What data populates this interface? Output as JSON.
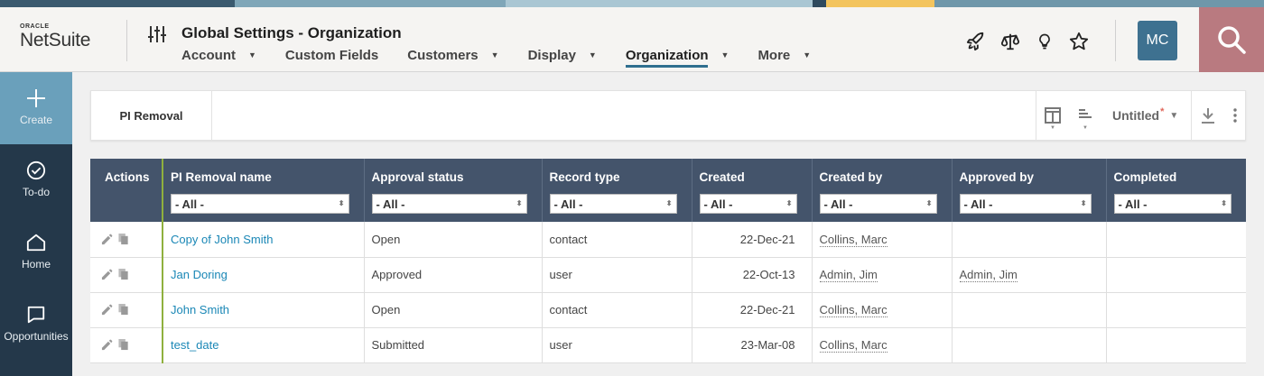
{
  "brand": {
    "oracle": "ORACLE",
    "product": "NetSuite"
  },
  "header": {
    "title": "Global Settings - Organization",
    "nav": [
      {
        "label": "Account",
        "has_menu": true
      },
      {
        "label": "Custom Fields",
        "has_menu": false
      },
      {
        "label": "Customers",
        "has_menu": true
      },
      {
        "label": "Display",
        "has_menu": true
      },
      {
        "label": "Organization",
        "has_menu": true,
        "active": true
      },
      {
        "label": "More",
        "has_menu": true
      }
    ],
    "icons": [
      "rocket-icon",
      "scale-icon",
      "lightbulb-icon",
      "star-icon"
    ],
    "avatar": "MC",
    "accent_color": "#2f6f8f"
  },
  "sidebar": {
    "items": [
      {
        "label": "Create",
        "icon": "plus-icon"
      },
      {
        "label": "To-do",
        "icon": "check-circle-icon"
      },
      {
        "label": "Home",
        "icon": "home-icon"
      },
      {
        "label": "Opportunities",
        "icon": "chat-bubble-icon"
      }
    ]
  },
  "saved_search": {
    "tab_label": "PI Removal",
    "view_name": "Untitled",
    "modified_marker": "*"
  },
  "table": {
    "columns": [
      {
        "label": "Actions",
        "filter": null
      },
      {
        "label": "PI Removal name",
        "filter": "- All -"
      },
      {
        "label": "Approval status",
        "filter": "- All -"
      },
      {
        "label": "Record type",
        "filter": "- All -"
      },
      {
        "label": "Created",
        "filter": "- All -"
      },
      {
        "label": "Created by",
        "filter": "- All -"
      },
      {
        "label": "Approved by",
        "filter": "- All -"
      },
      {
        "label": "Completed",
        "filter": "- All -"
      }
    ],
    "rows": [
      {
        "name": "Copy of John Smith",
        "status": "Open",
        "record_type": "contact",
        "created": "22-Dec-21",
        "created_by": "Collins, Marc",
        "approved_by": "",
        "completed": ""
      },
      {
        "name": "Jan Doring",
        "status": "Approved",
        "record_type": "user",
        "created": "22-Oct-13",
        "created_by": "Admin, Jim",
        "approved_by": "Admin, Jim",
        "completed": ""
      },
      {
        "name": "John Smith",
        "status": "Open",
        "record_type": "contact",
        "created": "22-Dec-21",
        "created_by": "Collins, Marc",
        "approved_by": "",
        "completed": ""
      },
      {
        "name": "test_date",
        "status": "Submitted",
        "record_type": "user",
        "created": "23-Mar-08",
        "created_by": "Collins, Marc",
        "approved_by": "",
        "completed": ""
      }
    ]
  }
}
